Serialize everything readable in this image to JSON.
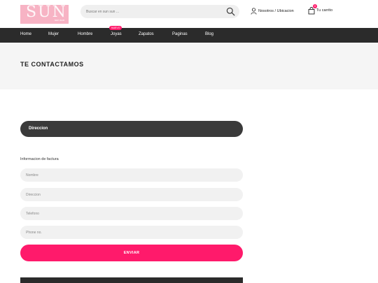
{
  "header": {
    "logo_text": "SUN",
    "logo_sub": "sun sun",
    "search_placeholder": "Buscar en sun sun ...",
    "account_label": "Nosotros / Ubicacion",
    "cart_label": "Tu carrito",
    "cart_count": "0"
  },
  "nav": {
    "items": [
      "Home",
      "Mujer",
      "Hombre",
      "Joyas",
      "Zapatos",
      "Paginas",
      "Blog"
    ],
    "badge": "NUEVO"
  },
  "page": {
    "title": "TE CONTACTAMOS"
  },
  "form": {
    "section_label": "Direccion",
    "group_label": "Informacion de factura",
    "fields": [
      {
        "placeholder": "Nombre"
      },
      {
        "placeholder": "Direccion"
      },
      {
        "placeholder": "Telefono"
      },
      {
        "placeholder": "Phone no."
      }
    ],
    "submit_label": "ENVIAR"
  },
  "colors": {
    "accent": "#ff1a6b",
    "dark": "#2b2b2b",
    "logo_bg": "#f7b3c4"
  }
}
